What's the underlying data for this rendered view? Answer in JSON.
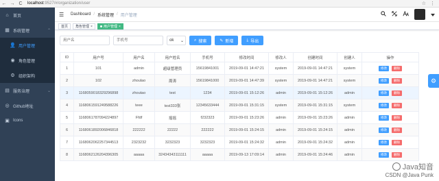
{
  "browser": {
    "back": "←",
    "forward": "→",
    "reload": "C",
    "url_host": "localhost",
    "url_path": ":9527/#/organization/user",
    "star": "☆",
    "menu": "⋮"
  },
  "sidebar": {
    "items": [
      {
        "icon": "⌂",
        "label": "首页"
      },
      {
        "icon": "▦",
        "label": "系统管理",
        "arrow": "⌃"
      },
      {
        "icon": "👤",
        "label": "用户管理"
      },
      {
        "icon": "◉",
        "label": "角色管理"
      },
      {
        "icon": "⚙",
        "label": "组织架构"
      },
      {
        "icon": "▤",
        "label": "服务治理",
        "arrow": "⌄"
      },
      {
        "icon": "◎",
        "label": "Github地址"
      },
      {
        "icon": "▣",
        "label": "Icons"
      }
    ]
  },
  "navbar": {
    "hamburger": "☰",
    "breadcrumb": [
      "Dashboard",
      "系统管理",
      "用户管理"
    ],
    "sep": "/"
  },
  "tags": [
    {
      "label": "首页"
    },
    {
      "label": "角色管理",
      "close": "×"
    },
    {
      "label": "用户管理",
      "close": "×"
    }
  ],
  "filters": {
    "username_placeholder": "用户名",
    "phone_placeholder": "手机号",
    "select_value": "ok",
    "select_arrow": "⌄",
    "search_label": "搜索",
    "search_icon": "⌕",
    "add_label": "新增",
    "add_icon": "✎",
    "export_label": "导出",
    "export_icon": "⤓"
  },
  "table": {
    "headers": [
      "ID",
      "用户号",
      "用户名",
      "用户姓名",
      "手机号",
      "修改时间",
      "修改人",
      "创建时间",
      "创建人",
      "操作"
    ],
    "rows": [
      [
        "1",
        "101",
        "admin",
        "超级管理员",
        "15619841001",
        "2019-09-01 14:47:21",
        "system",
        "2019-09-01 14:47:21",
        "system"
      ],
      [
        "2",
        "102",
        "zhoulao",
        "周涛",
        "15619841000",
        "2019-09-01 14:47:39",
        "system",
        "2019-09-01 14:47:21",
        "system"
      ],
      [
        "3",
        "1168059018329296898",
        "zhoutao",
        "test",
        "1234",
        "2019-09-01 15:12:26",
        "admin",
        "2019-09-01 15:12:26",
        "admin"
      ],
      [
        "4",
        "1168061591249588226",
        "teee",
        "test333张",
        "12345633444",
        "2019-09-01 15:31:15",
        "system",
        "2019-09-01 15:31:15",
        "system"
      ],
      [
        "5",
        "1168061787094224897",
        "Ffdf",
        "摇摇",
        "f232323",
        "2019-09-01 15:23:26",
        "admin",
        "2019-09-01 15:23:26",
        "admin"
      ],
      [
        "6",
        "1168061892006846818",
        "222222",
        "22222",
        "222222",
        "2019-09-01 15:24:15",
        "admin",
        "2019-09-01 15:24:15",
        "admin"
      ],
      [
        "7",
        "1168062062257344513",
        "2323232",
        "3232323",
        "3232323",
        "2019-09-01 15:24:32",
        "admin",
        "2019-09-01 15:24:32",
        "admin"
      ],
      [
        "8",
        "1168062126204396305",
        "aaaaa",
        "32434343111111",
        "aaaaa",
        "2019-09-13 17:09:14",
        "admin",
        "2019-09-01 15:24:46",
        "admin"
      ]
    ],
    "edit_label": "修改",
    "delete_label": "删除"
  },
  "settings_icon": "⚙",
  "watermark": {
    "main": "Java知音",
    "sub": "CSDN @Java Punk"
  },
  "colors": {
    "sidebar_bg": "#304156",
    "primary": "#409eff",
    "danger": "#f56c6c",
    "tag_active": "#42b983"
  }
}
